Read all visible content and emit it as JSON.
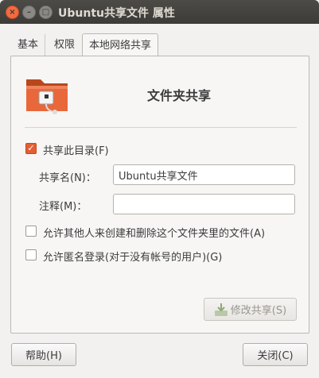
{
  "window": {
    "title": "Ubuntu共享文件 属性"
  },
  "tabs": [
    {
      "label": "基本"
    },
    {
      "label": "权限"
    },
    {
      "label": "本地网络共享"
    }
  ],
  "share_section": {
    "heading": "文件夹共享",
    "icon": "folder-share-icon",
    "share_checkbox_label": "共享此目录(F)",
    "share_checked": true,
    "share_name_label": "共享名(N)：",
    "share_name_value": "Ubuntu共享文件",
    "comment_label": "注释(M)：",
    "comment_value": "",
    "allow_others_label": "允许其他人来创建和删除这个文件夹里的文件(A)",
    "allow_others_checked": false,
    "guest_label": "允许匿名登录(对于没有帐号的用户)(G)",
    "guest_checked": false,
    "modify_button": "修改共享(S)"
  },
  "footer": {
    "help_button": "帮助(H)",
    "close_button": "关闭(C)"
  },
  "colors": {
    "accent": "#e45e33",
    "titlebar": "#3c3b37",
    "background": "#f2f1f0"
  }
}
